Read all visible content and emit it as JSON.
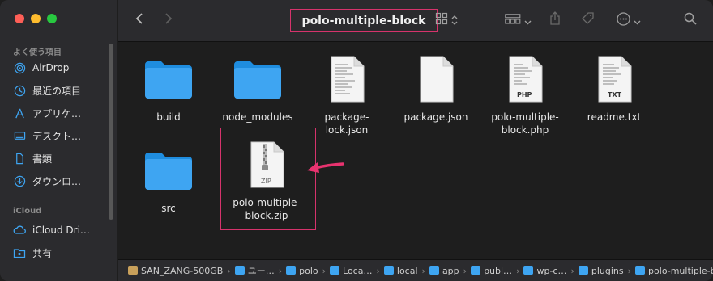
{
  "window": {
    "title": "polo-multiple-block",
    "accent_color": "#d6336c",
    "folder_color": "#3ea5f2"
  },
  "sidebar": {
    "favorites_heading": "よく使う項目",
    "favorites": [
      {
        "label": "AirDrop",
        "icon": "airdrop-icon"
      },
      {
        "label": "最近の項目",
        "icon": "clock-icon"
      },
      {
        "label": "アプリケ…",
        "icon": "applications-icon"
      },
      {
        "label": "デスクト…",
        "icon": "desktop-icon"
      },
      {
        "label": "書類",
        "icon": "document-icon"
      },
      {
        "label": "ダウンロ…",
        "icon": "download-icon"
      }
    ],
    "icloud_heading": "iCloud",
    "icloud": [
      {
        "label": "iCloud Dri…",
        "icon": "cloud-icon"
      },
      {
        "label": "共有",
        "icon": "shared-folder-icon"
      }
    ]
  },
  "files": [
    {
      "name_line1": "build",
      "name_line2": "",
      "type": "folder"
    },
    {
      "name_line1": "node_modules",
      "name_line2": "",
      "type": "folder"
    },
    {
      "name_line1": "package-",
      "name_line2": "lock.json",
      "type": "text-document"
    },
    {
      "name_line1": "package.json",
      "name_line2": "",
      "type": "blank-document"
    },
    {
      "name_line1": "polo-multiple-",
      "name_line2": "block.php",
      "type": "php-document",
      "badge": "PHP"
    },
    {
      "name_line1": "readme.txt",
      "name_line2": "",
      "type": "txt-document",
      "badge": "TXT"
    },
    {
      "name_line1": "src",
      "name_line2": "",
      "type": "folder"
    },
    {
      "name_line1": "polo-multiple-",
      "name_line2": "block.zip",
      "type": "zip-archive",
      "badge": "ZIP"
    }
  ],
  "pathbar": [
    {
      "label": "SAN_ZANG-500GB",
      "icon": "drive-icon"
    },
    {
      "label": "ユー…",
      "icon": "folder-icon"
    },
    {
      "label": "polo",
      "icon": "folder-icon"
    },
    {
      "label": "Loca…",
      "icon": "folder-icon"
    },
    {
      "label": "local",
      "icon": "folder-icon"
    },
    {
      "label": "app",
      "icon": "folder-icon"
    },
    {
      "label": "publ…",
      "icon": "folder-icon"
    },
    {
      "label": "wp-c…",
      "icon": "folder-icon"
    },
    {
      "label": "plugins",
      "icon": "folder-icon"
    },
    {
      "label": "polo-multiple-block",
      "icon": "folder-icon"
    }
  ]
}
